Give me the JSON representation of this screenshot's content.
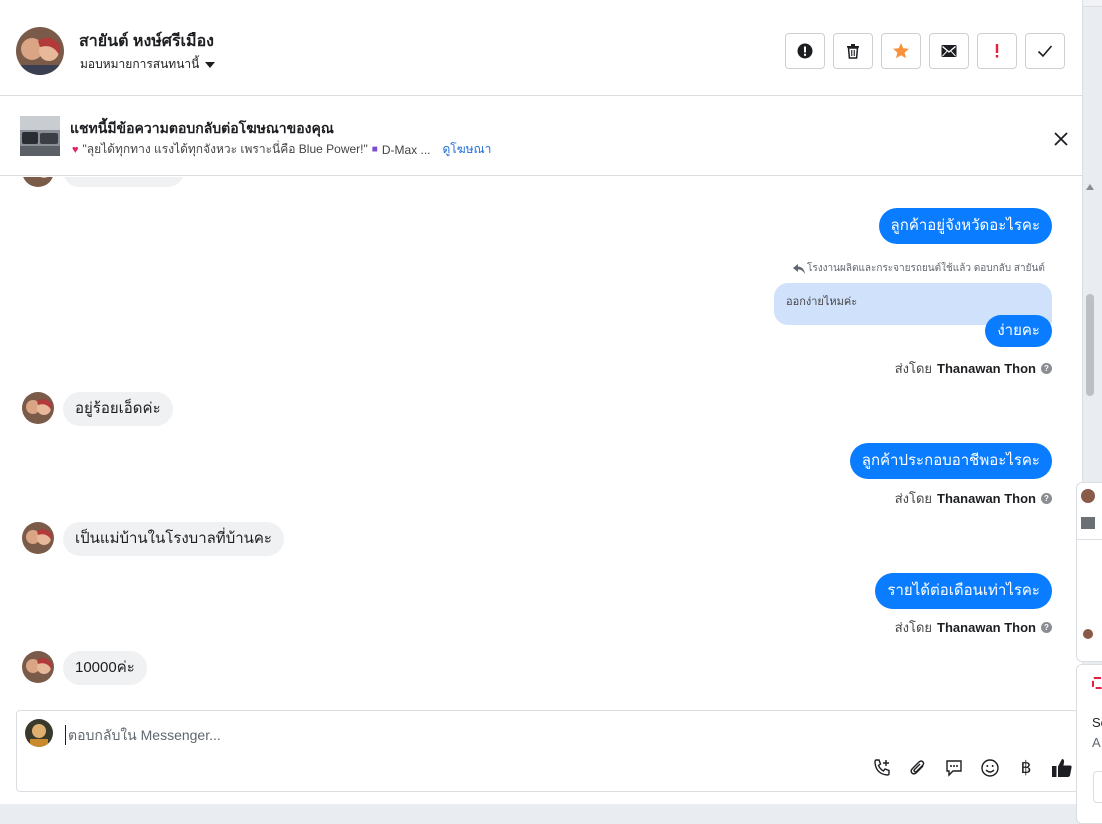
{
  "header": {
    "contact_name": "สายันต์ หงษ์ศรีเมือง",
    "assign_label": "มอบหมายการสนทนานี้",
    "actions": [
      "mark-alert",
      "delete",
      "star",
      "mail",
      "important",
      "done"
    ]
  },
  "ad": {
    "title": "แชทนี้มีข้อความตอบกลับต่อโฆษณาของคุณ",
    "snippet": "\"ลุยได้ทุกทาง แรงได้ทุกจังหวะ เพราะนี่คือ Blue Power!\"",
    "snippet_tail": "D-Max ...",
    "link": "ดูโฆษณา"
  },
  "messages": {
    "partial_top": "ออกง่ายไหมคะ",
    "out1": "ลูกค้าอยู่จังหวัดอะไรคะ",
    "reply_note": "โรงงานผลิตและกระจายรถยนต์ใช้แล้ว ตอบกลับ สายันต์",
    "quoted": "ออกง่ายไหมค่ะ",
    "out2": "ง่ายคะ",
    "in1": "อยู่ร้อยเอ็ดค่ะ",
    "out3": "ลูกค้าประกอบอาชีพอะไรคะ",
    "in2": "เป็นแม่บ้านในโรงบาลที่บ้านคะ",
    "out4": "รายได้ต่อเดือนเท่าไรคะ",
    "in3": "10000ค่ะ",
    "sent_by_prefix": "ส่งโดย",
    "sent_by_name": "Thanawan Thon"
  },
  "composer": {
    "placeholder": "ตอบกลับใน Messenger..."
  },
  "overlay": {
    "text1": "Sc",
    "text2": "A"
  },
  "colors": {
    "accent": "#0a7cff",
    "incoming": "#eff1f3",
    "quote": "#cfe1fb",
    "star": "#f7923b",
    "important": "#e41e3f"
  }
}
